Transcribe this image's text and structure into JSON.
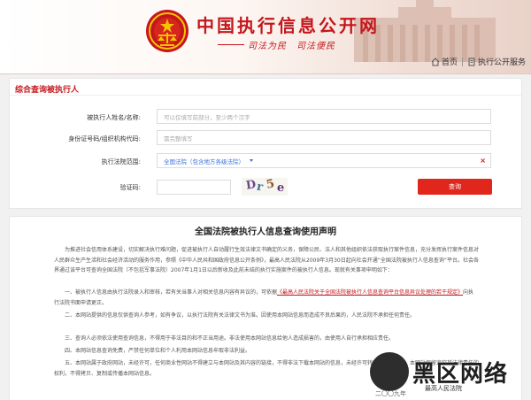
{
  "header": {
    "title": "中国执行信息公开网",
    "slogan": "司法为民　司法便民",
    "nav": [
      {
        "label": "首页",
        "icon": "home-icon"
      },
      {
        "label": "执行公开服务",
        "icon": "document-icon"
      }
    ]
  },
  "query": {
    "title": "综合查询被执行人",
    "name_label": "被执行人姓名/名称:",
    "name_placeholder": "可以仅填写前部分，至少两个汉字",
    "id_label": "身份证号码/组织机构代码:",
    "id_placeholder": "需完整填写",
    "court_label": "执行法院范围:",
    "court_value": "全国法院（包含地方各级法院）",
    "captcha_label": "验证码:",
    "captcha_text": "Dr5e",
    "submit_label": "查询"
  },
  "statement": {
    "title": "全国法院被执行人信息查询使用声明",
    "p1": "为推进社会信用体系建设，切实解决执行难问题，促进被执行人自动履行生效法律文书确定的义务，保障公民、法人和其他组织依法获取执行案件信息，充分发挥执行案件信息对人民群众生产生活和社会经济活动的服务作用，参照《中华人民共和国政府信息公开条例》，最高人民法院从2009年3月30日起向社会开通“全国法院被执行人信息查询”平台。社会各界通过该平台可查询全国法院（不包括军事法院）2007年1月1日以后新收及此前未结的执行实施案件的被执行人信息。现就有关事项申明如下：",
    "p2_before": "一、被执行人信息由执行法院录入和审核，若有关当事人对相关信息内容有异议的，可依据",
    "p2_link": "《最高人民法院关于全国法院被执行人信息查询平台信息异议处理的若干规定》",
    "p2_after": "向执行法院书面申请更正。",
    "p3": "二、本网站提供的信息仅供查询人参考，如有争议，以执行法院有关法律文书为准。因使用本网站信息而造成不良后果的，人民法院不承担任何责任。",
    "p4": "三、查询人必须依法使用查询信息，不得用于非法目的和不正当用途。非法使用本网站信息给他人造成损害的，由使用人自行承担相应责任。",
    "p5": "四、本网站信息查询免费，严禁任何单位和个人利用本网站信息牟取非法利益。",
    "p6": "五、本网站属于政府网站，未经许可，任何商业性网站不得建立与本网站及其内容的链接，不得非法下载本网站的信息，未经许可转载本网站内容，本网站保留追究其法律责任的权利，不得拷贝、复制或传播本网站信息。"
  },
  "watermark": {
    "text": "黑区网络",
    "sub": "最高人民法院",
    "date": "二〇〇九年"
  },
  "colors": {
    "brand_red": "#c4161c",
    "button_red": "#e1261c",
    "link_blue": "#3a6fd8"
  }
}
